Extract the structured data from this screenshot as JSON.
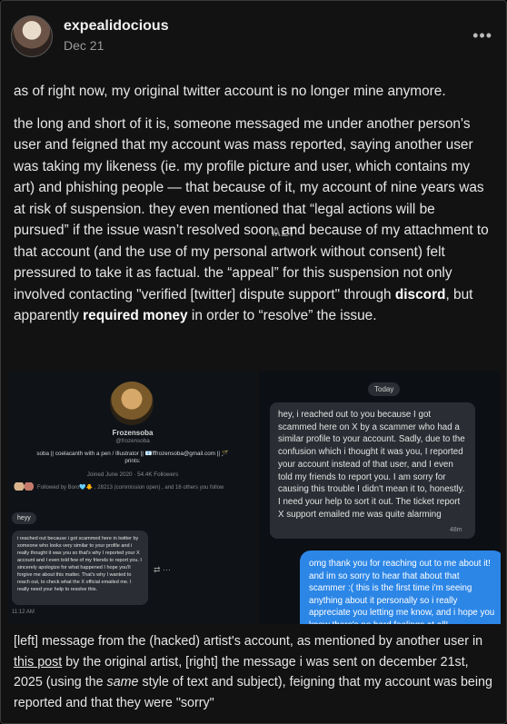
{
  "author": {
    "username": "expealidocious",
    "date": "Dec 21",
    "more": "•••"
  },
  "post": {
    "p1": "as of right now, my original twitter account is no longer mine anymore.",
    "p2_a": "the long and short of it is, someone messaged me under another person's user and feigned that my account was mass reported, saying another user was taking my likeness (ie. my profile picture and user, which contains my art) and phishing people — that because of it, my account of nine years was at risk of suspension. they even mentioned that “legal actions will be pursued” if the issue wasn’t resolved soon, and because of my attachment to that account (and the use of my personal artwork without consent) felt pressured to take it as factual. the “appeal” for this suspension not only involved contacting \"verified [twitter] dispute support\" through ",
    "p2_bold1": "discord",
    "p2_b": ", but apparently ",
    "p2_bold2": "required money",
    "p2_c": " in order to “resolve” the issue."
  },
  "left_image": {
    "name": "Frozensoba",
    "handle": "@frozensoba",
    "bio_1": "soba || coelacanth with a pen / Illustrator || 📧fffrozensoba@gmail.com || 🪄",
    "bio_2": "prints:",
    "joined": "Joined June 2020 · 54.4K Followers",
    "followed_by": "Followed by Boro🩵🐥 , 28213 (commission open) , and 16 others you follow",
    "msg1": "heyy",
    "msg2": "i reached out because i got scammed here in twitter by someone who looks very similar to your profile and i really thought it was you so that's why I reported your X account and I even told few of my friends to report you. I sincerely apologize for what happened I hope you'll forgive me about this matter. That's why I wanted to reach out, to check what the X official emailed me. I really need your help to resolve this.",
    "time": "11:12 AM"
  },
  "right_image": {
    "today": "Today",
    "grey_msg": "hey, i reached out to you because I got scammed here on X by a scammer who had a similar profile to your account. Sadly, due to the confusion which i thought it was you, I reported your account instead of that user, and I even told my friends to report you. I am sorry for causing this trouble I didn't mean it to, honestly. I need your help to sort it out. The ticket report X support emailed me was quite alarming",
    "grey_time": "48m",
    "blue_msg": "omg thank you for reaching out to me about it! and im so sorry to hear that about that scammer :( this is the first time i'm seeing anything about it personally so i really appreciate you letting me know, and i hope you know there's no hard feelings at all!"
  },
  "alt_badge": "ALT",
  "caption": {
    "a": "[left] message from the (hacked) artist's account, as mentioned by another user in ",
    "link": "this post",
    "b": " by the original artist, [right] the message i was sent on december 21st, 2025 (using the ",
    "em": "same",
    "c": " style of text and subject), feigning that my account was being reported and that they were \"sorry\""
  }
}
